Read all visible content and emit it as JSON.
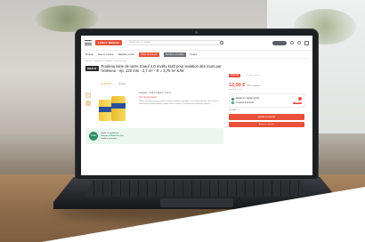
{
  "header": {
    "logo_text": "LEROY MERLIN",
    "search_placeholder": "Rechercher un produit",
    "brand_color": "#e8503a"
  },
  "nav": {
    "items": [
      "Produits",
      "Idées et conseils",
      "Matériaux et bois",
      "Offres du moment",
      "Services et location",
      "Projets"
    ]
  },
  "breadcrumb": "Accueil > Matériaux > Isolation > Laine de verre",
  "product": {
    "brand": "KNAUF",
    "title": "Rouleau laine de verre Knauf 4.0 revêtu kraft pour isolation des murs par l'intérieur - ép. 120 mm - 2,7 m² - R = 3,75 m².K/W",
    "stars": "★★★★☆",
    "rating_text": "(8 avis)",
    "desc_head": "Longueur : 5,90 m   Largeur : 0,60 m",
    "desc_sub": "Voir la description",
    "desc_body": "Rouleau de laine de verre revêtu kraft pour l'isolation thermique et acoustique des murs par l'intérieur. Pose facile et rapide, découpe simple avec un couteau. Performances thermiques élevées.",
    "thumb_count": 2
  },
  "seller": {
    "logo": "TRAV",
    "line1": "Vendu et expédié par",
    "line2": "Travaux et Matériaux Pro",
    "line3": "Vendeur partenaire"
  },
  "buybox": {
    "badge": "Nouveau",
    "promo": "Prix bas garanti",
    "price": "12,90 €",
    "price_unit": "TTC / rouleau",
    "price_sub": "soit 4,78 € / m²",
    "option_1": "Retrait en magasin gratuit",
    "option_2": "Livraison à domicile",
    "ship_button": "Choisir",
    "qty": "Quantité : 1",
    "cta": "Ajouter au panier",
    "cta2": "Ajouter à une liste"
  }
}
